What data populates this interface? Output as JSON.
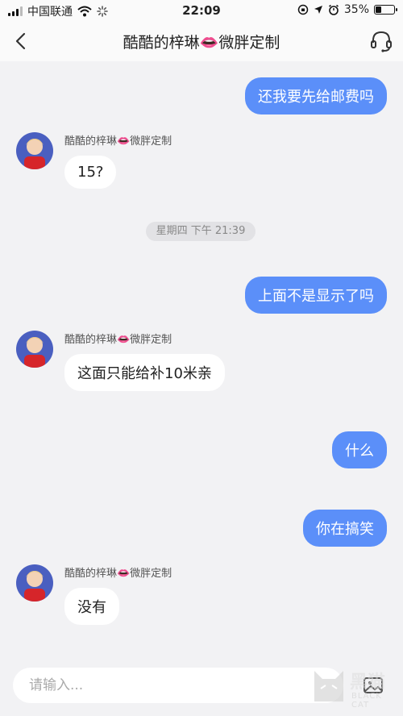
{
  "status_bar": {
    "carrier": "中国联通",
    "time": "22:09",
    "battery": "35%",
    "battery_level": 0.35
  },
  "header": {
    "title": "酷酷的梓琳👄微胖定制"
  },
  "messages": [
    {
      "side": "right",
      "text": "还我要先给邮费吗"
    },
    {
      "side": "left",
      "sender": "酷酷的梓琳👄微胖定制",
      "text": "15?"
    },
    {
      "side": "time",
      "text": "星期四 下午 21:39"
    },
    {
      "side": "right",
      "text": "上面不是显示了吗"
    },
    {
      "side": "left",
      "sender": "酷酷的梓琳👄微胖定制",
      "text": "这面只能给补10米亲"
    },
    {
      "side": "right",
      "text": "什么"
    },
    {
      "side": "right",
      "text": "你在搞笑"
    },
    {
      "side": "left",
      "sender": "酷酷的梓琳👄微胖定制",
      "text": "没有"
    }
  ],
  "input": {
    "placeholder": "请输入..."
  },
  "watermark": {
    "text": "黑猫",
    "sub": "BLACK CAT"
  },
  "colors": {
    "accent": "#5b8ff9",
    "background": "#f2f2f4"
  }
}
